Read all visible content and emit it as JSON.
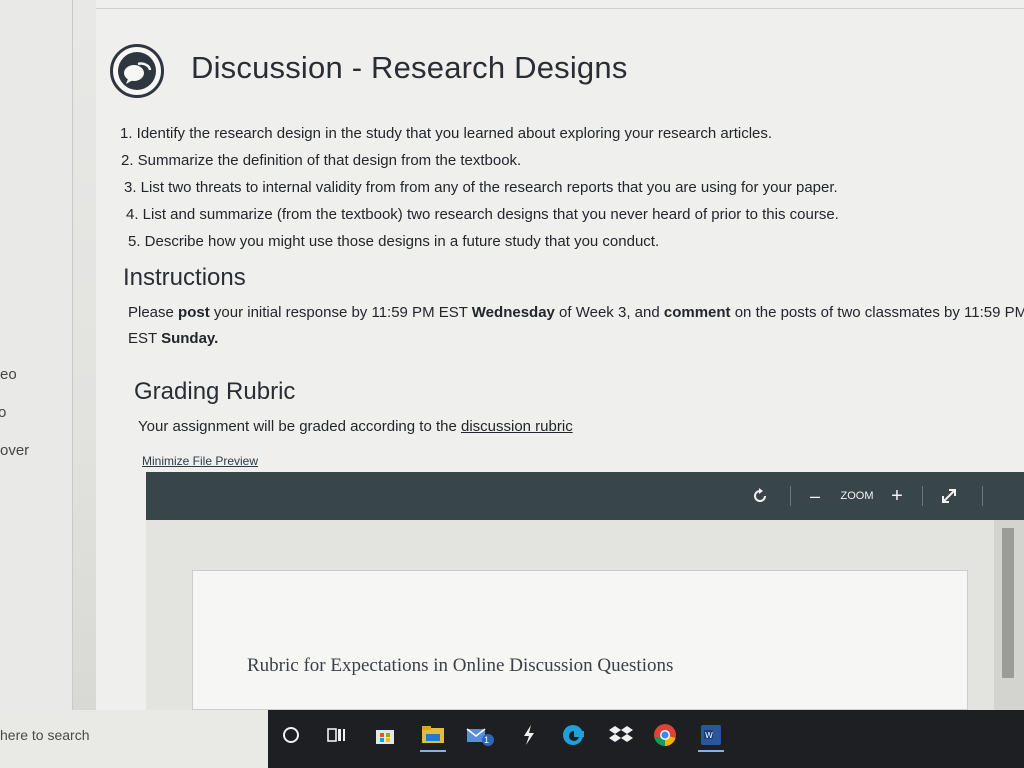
{
  "sidebar": {
    "fragments": [
      "eo",
      "o",
      "over"
    ]
  },
  "discussion": {
    "title": "Discussion - Research Designs",
    "questions": [
      "1. Identify the research design in the study that you learned about exploring your research articles.",
      "2. Summarize the definition of that design from the textbook.",
      "3. List two threats to internal validity from from any of the research reports that you are using for your paper.",
      "4. List and summarize (from the textbook) two research designs that you never heard of prior to this course.",
      "5. Describe how you might use those designs in a future study that you conduct."
    ]
  },
  "instructions": {
    "heading": "Instructions",
    "p1": "Please ",
    "b1": "post",
    "p2": " your initial response by 11:59 PM EST ",
    "b2": "Wednesday",
    "p3": " of Week 3, and ",
    "b3": "comment",
    "p4": " on the posts of two classmates by 11:59 PM EST ",
    "b4": "Sunday."
  },
  "rubric": {
    "heading": "Grading Rubric",
    "text": "Your assignment will be graded according to the ",
    "link_text": "discussion rubric",
    "minimize_link": "Minimize File Preview"
  },
  "viewer": {
    "zoom_label": "ZOOM",
    "minus": "–",
    "plus": "+",
    "doc_title": "Rubric for Expectations in Online Discussion Questions"
  },
  "taskbar": {
    "search_placeholder": "here to search",
    "mail_badge": "1"
  },
  "colors": {
    "viewer_bar": "#38464a",
    "taskbar": "#1d1f22",
    "accent_underline": "#7fb4e6"
  }
}
